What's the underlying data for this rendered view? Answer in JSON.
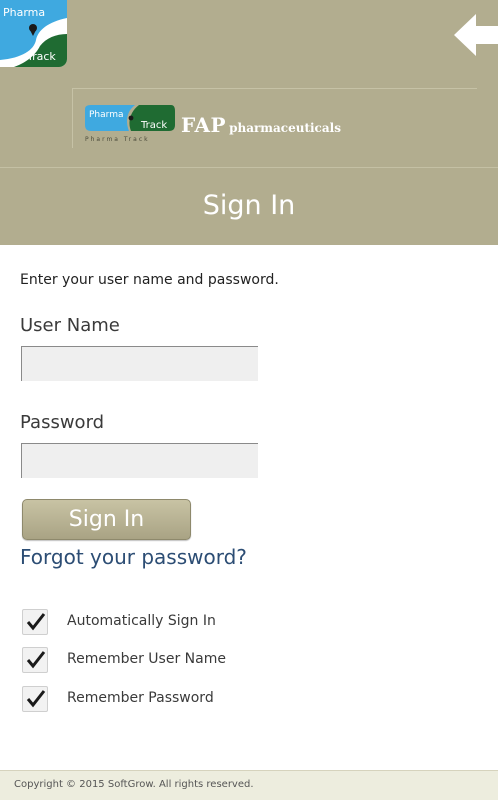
{
  "app_logo": {
    "line1": "Pharma",
    "line2": "Track",
    "icon": "map-pin-icon"
  },
  "header": {
    "back_icon": "back-arrow-icon",
    "brand": {
      "logo_line1": "Pharma",
      "logo_line2": "Track",
      "logo_tagline": "Pharma Track",
      "name_big": "FAP",
      "name_small": "pharmaceuticals"
    },
    "title": "Sign In"
  },
  "form": {
    "instructions": "Enter your user name and password.",
    "username_label": "User Name",
    "username_value": "",
    "password_label": "Password",
    "password_value": "",
    "signin_label": "Sign In",
    "forgot_label": "Forgot your password?"
  },
  "options": [
    {
      "label": "Automatically Sign In",
      "checked": true
    },
    {
      "label": "Remember User Name",
      "checked": true
    },
    {
      "label": "Remember Password",
      "checked": true
    }
  ],
  "footer": {
    "copyright": "Copyright © 2015 SoftGrow. All rights reserved."
  },
  "colors": {
    "header_bg": "#b2ad8f",
    "link": "#2c4d74",
    "logo_blue": "#3fa9e0",
    "logo_green": "#1f6b32"
  }
}
